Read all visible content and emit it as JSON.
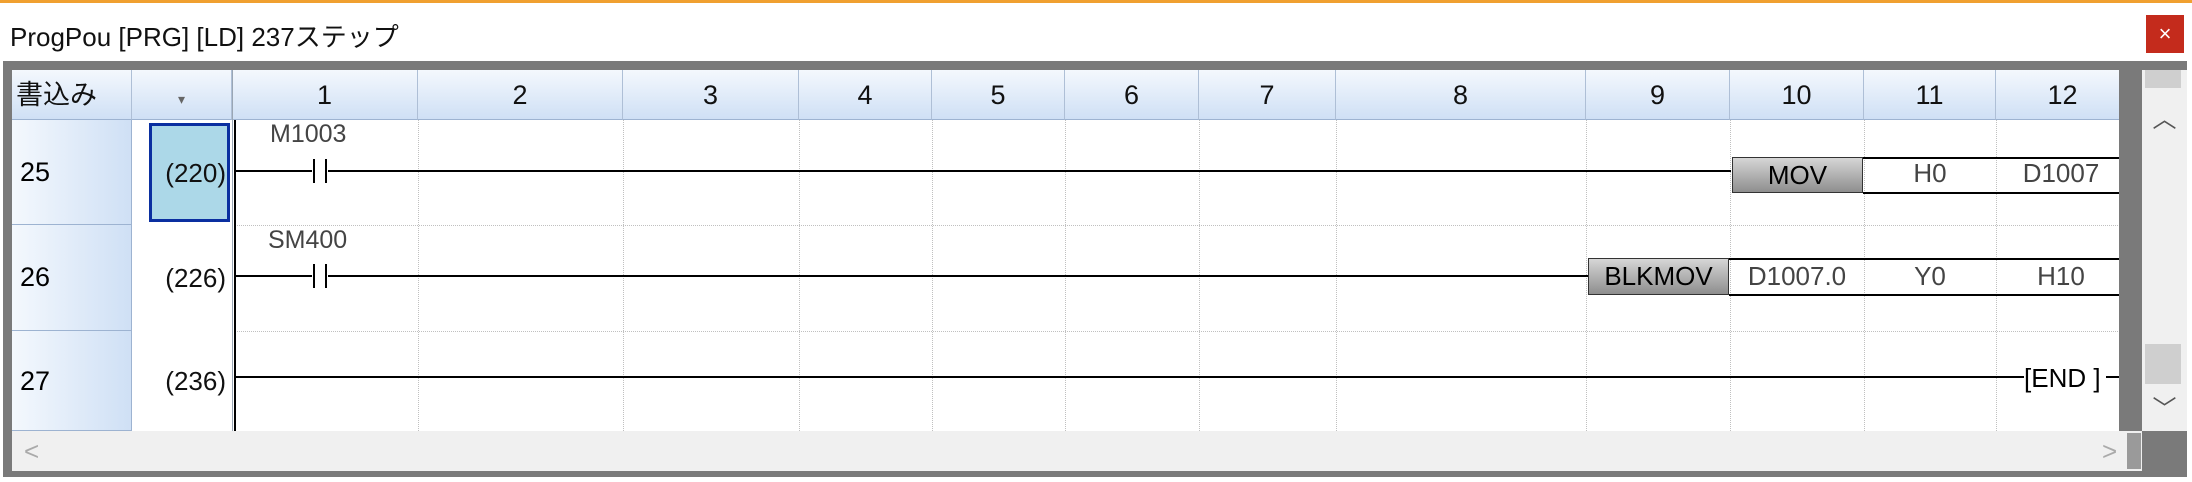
{
  "window": {
    "title": "ProgPou [PRG] [LD] 237ステップ",
    "close_label": "×",
    "accent_color": "#f0a030",
    "close_color": "#c42b1c"
  },
  "header": {
    "mode_label": "書込み",
    "dropdown_icon": "▾",
    "columns": [
      "1",
      "2",
      "3",
      "4",
      "5",
      "6",
      "7",
      "8",
      "9",
      "10",
      "11",
      "12"
    ]
  },
  "rows": [
    {
      "num": "25",
      "step": "(220)",
      "contact": "M1003",
      "instruction": "MOV",
      "operands": [
        "H0",
        "D1007"
      ],
      "selected": true
    },
    {
      "num": "26",
      "step": "(226)",
      "contact": "SM400",
      "instruction": "BLKMOV",
      "operands": [
        "D1007.0",
        "Y0",
        "H10"
      ],
      "selected": false
    },
    {
      "num": "27",
      "step": "(236)",
      "end_label": "[END ]"
    }
  ],
  "scrollbars": {
    "up_icon": "︿",
    "down_icon": "﹀",
    "left_icon": "<",
    "right_icon": ">"
  },
  "colors": {
    "selection_fill": "#acd8e8",
    "selection_border": "#0a2fa0",
    "header_gradient_bottom": "#cfe0f5"
  }
}
